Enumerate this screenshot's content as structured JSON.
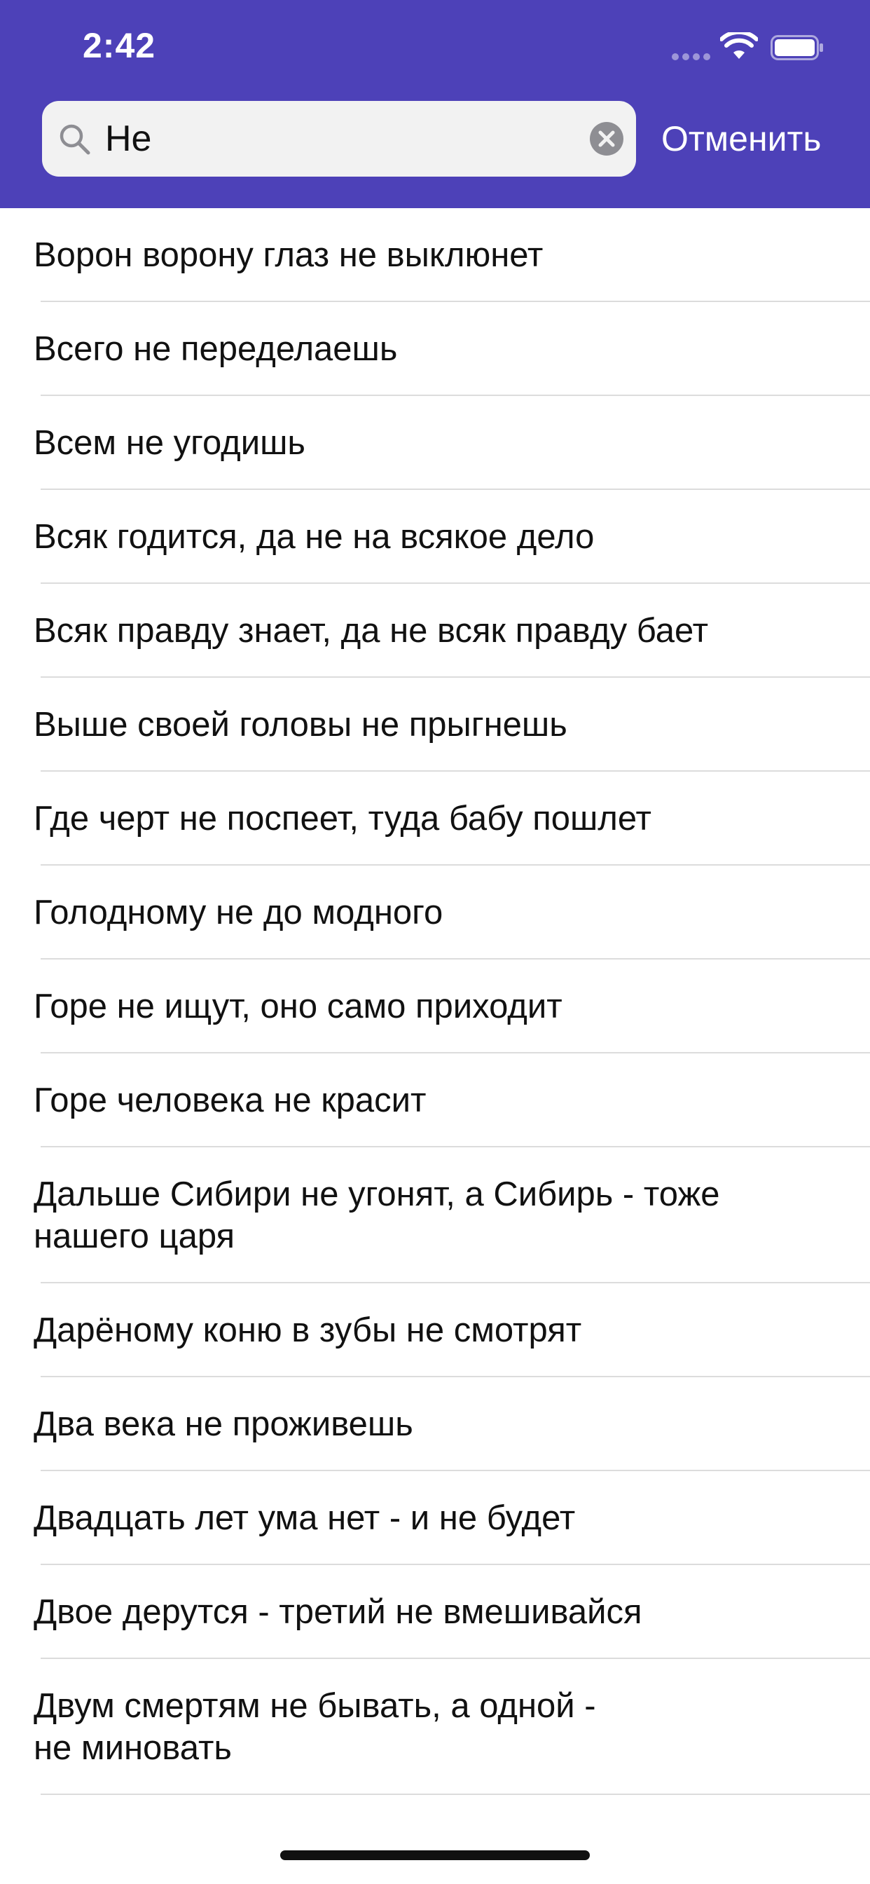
{
  "status_bar": {
    "time": "2:42",
    "icons": [
      "cellular-signal-icon",
      "wifi-icon",
      "battery-icon"
    ]
  },
  "search": {
    "value": "Не",
    "placeholder": "",
    "cancel_label": "Отменить"
  },
  "colors": {
    "header": "#4d41b8",
    "search_field": "#f2f2f2",
    "text": "#111111",
    "separator": "#dcdcdc"
  },
  "results": [
    {
      "line1": "Ворон ворону глаз не выклюнет",
      "line2": ""
    },
    {
      "line1": "Всего не переделаешь",
      "line2": ""
    },
    {
      "line1": "Всем не угодишь",
      "line2": ""
    },
    {
      "line1": "Всяк годится, да не на всякое дело",
      "line2": ""
    },
    {
      "line1": "Всяк правду знает, да не всяк правду бает",
      "line2": ""
    },
    {
      "line1": "Выше своей головы не прыгнешь",
      "line2": ""
    },
    {
      "line1": "Где черт не поспеет, туда бабу пошлет",
      "line2": ""
    },
    {
      "line1": "Голодному не до модного",
      "line2": ""
    },
    {
      "line1": "Горе не ищут, оно само приходит",
      "line2": ""
    },
    {
      "line1": "Горе человека не красит",
      "line2": ""
    },
    {
      "line1": "Дальше Сибири не угонят, а Сибирь - тоже",
      "line2": "нашего царя"
    },
    {
      "line1": "Дарёному коню в зубы не смотрят",
      "line2": ""
    },
    {
      "line1": "Два века не проживешь",
      "line2": ""
    },
    {
      "line1": "Двадцать лет ума нет - и не будет",
      "line2": ""
    },
    {
      "line1": "Двое дерутся - третий не вмешивайся",
      "line2": ""
    },
    {
      "line1": "Двум смертям не бывать, а одной -",
      "line2": "не миновать"
    }
  ]
}
